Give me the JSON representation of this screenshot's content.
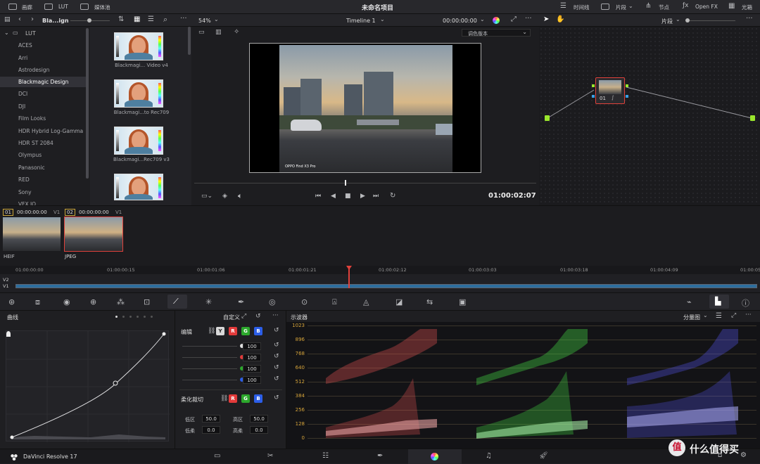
{
  "topbar": {
    "media_pool": "画廊",
    "lut": "LUT",
    "media_library": "媒体池",
    "project_title": "未命名项目",
    "timeline": "时间线",
    "clips": "片段",
    "nodes": "节点",
    "openfx": "Open FX",
    "lightbox": "光箱"
  },
  "bar2": {
    "lut_folder": "Bla...ign",
    "zoom": "54%",
    "timeline_name": "Timeline 1",
    "timecode": "00:00:00:00",
    "clip_mode": "片段"
  },
  "lut_tree": {
    "root": "LUT",
    "items": [
      "ACES",
      "Arri",
      "Astrodesign",
      "Blackmagic Design",
      "DCI",
      "DJI",
      "Film Looks",
      "HDR Hybrid Log-Gamma",
      "HDR ST 2084",
      "Olympus",
      "Panasonic",
      "RED",
      "Sony",
      "VFX IO"
    ],
    "selected_index": 3
  },
  "lut_thumbs": [
    "Blackmagi... Video v4",
    "Blackmagi...to Rec709",
    "Blackmagi...Rec709 v3"
  ],
  "viewer": {
    "grade_version": "调色版本",
    "watermark": "OPPO Find X3 Pro",
    "timecode": "01:00:02:07",
    "playhead": 0.44
  },
  "node": {
    "label": "01"
  },
  "clips": [
    {
      "index": "01",
      "tc": "00:00:00:00",
      "track": "V1",
      "format": "HEIF",
      "selected": false
    },
    {
      "index": "02",
      "tc": "00:00:00:00",
      "track": "V1",
      "format": "JPEG",
      "selected": true
    }
  ],
  "timeline_ruler": [
    "01:00:00:00",
    "01:00:00:15",
    "01:00:01:06",
    "01:00:01:21",
    "01:00:02:12",
    "01:00:03:03",
    "01:00:03:18",
    "01:00:04:09",
    "01:00:05"
  ],
  "tracks": [
    "V2",
    "V1"
  ],
  "curves": {
    "title": "曲线",
    "mode": "自定义",
    "edit_label": "编辑",
    "channels": [
      "Y",
      "R",
      "G",
      "B"
    ],
    "intensity": [
      "100",
      "100",
      "100",
      "100"
    ],
    "soft_clip_label": "柔化裁切",
    "low_label": "低区",
    "low_value": "50.0",
    "high_label": "高区",
    "high_value": "50.0",
    "low_soft_label": "低柔",
    "low_soft_value": "0.0",
    "high_soft_label": "高柔",
    "high_soft_value": "0.0"
  },
  "scope": {
    "title": "示波器",
    "mode": "分量图",
    "y_labels": [
      "1023",
      "896",
      "768",
      "640",
      "512",
      "384",
      "256",
      "128",
      "0"
    ]
  },
  "app": {
    "name": "DaVinci Resolve 17",
    "watermark": "值 | 什么值得买"
  },
  "colors": {
    "accent_red": "#e0413b",
    "scope_red": "#ff5a5a",
    "scope_green": "#4dff4d",
    "scope_blue": "#5a5aff",
    "tick_orange": "#d6a43a"
  }
}
